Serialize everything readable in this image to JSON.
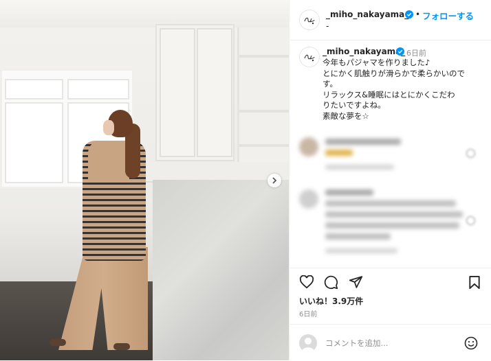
{
  "post": {
    "username": "_miho_nakayama_",
    "verified": true,
    "follow_label": "フォローする",
    "separator": "•",
    "header_sub": "-"
  },
  "caption": {
    "username": "_miho_nakayama_",
    "time": "6日前",
    "lines": [
      "今年もパジャマを作りました♪",
      "とにかく肌触りが滑らかで柔らかいので",
      "す。",
      "リラックス&睡眠にはとにかくこだわ",
      "りたいですよね。",
      "素敵な夢を☆"
    ]
  },
  "stats": {
    "likes": "いいね！3.9万件",
    "posted": "6日前"
  },
  "comment_box": {
    "placeholder": "コメントを追加..."
  },
  "icons": {
    "like": "heart-icon",
    "comment": "comment-icon",
    "share": "share-icon",
    "save": "bookmark-icon",
    "emoji": "smiley-icon",
    "next": "chevron-right-icon",
    "verified": "verified-badge-icon"
  },
  "colors": {
    "accent": "#0095f6",
    "text": "#262626",
    "muted": "#8e8e8e"
  }
}
